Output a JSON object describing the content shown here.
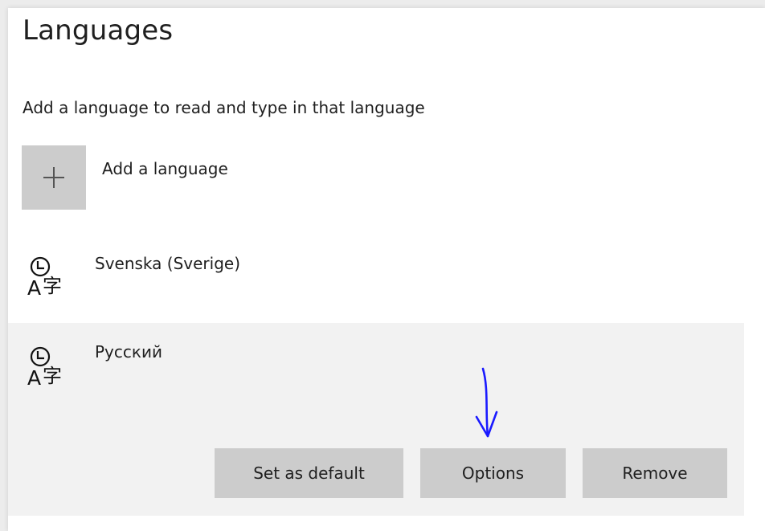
{
  "page": {
    "title": "Languages",
    "subtitle": "Add a language to read and type in that language"
  },
  "add_language": {
    "label": "Add a language",
    "icon": "plus-icon"
  },
  "languages": [
    {
      "name": "Svenska (Sverige)",
      "icon": "language-icon",
      "selected": false
    },
    {
      "name": "Русский",
      "icon": "language-icon",
      "selected": true
    }
  ],
  "actions": {
    "set_default_label": "Set as default",
    "options_label": "Options",
    "remove_label": "Remove"
  },
  "annotation": {
    "type": "hand-drawn-arrow",
    "color": "#1a1aff",
    "points_to": "options-button"
  },
  "colors": {
    "selected_row": "#f2f2f2",
    "button_bg": "#cccccc",
    "text": "#1f1f1f"
  }
}
